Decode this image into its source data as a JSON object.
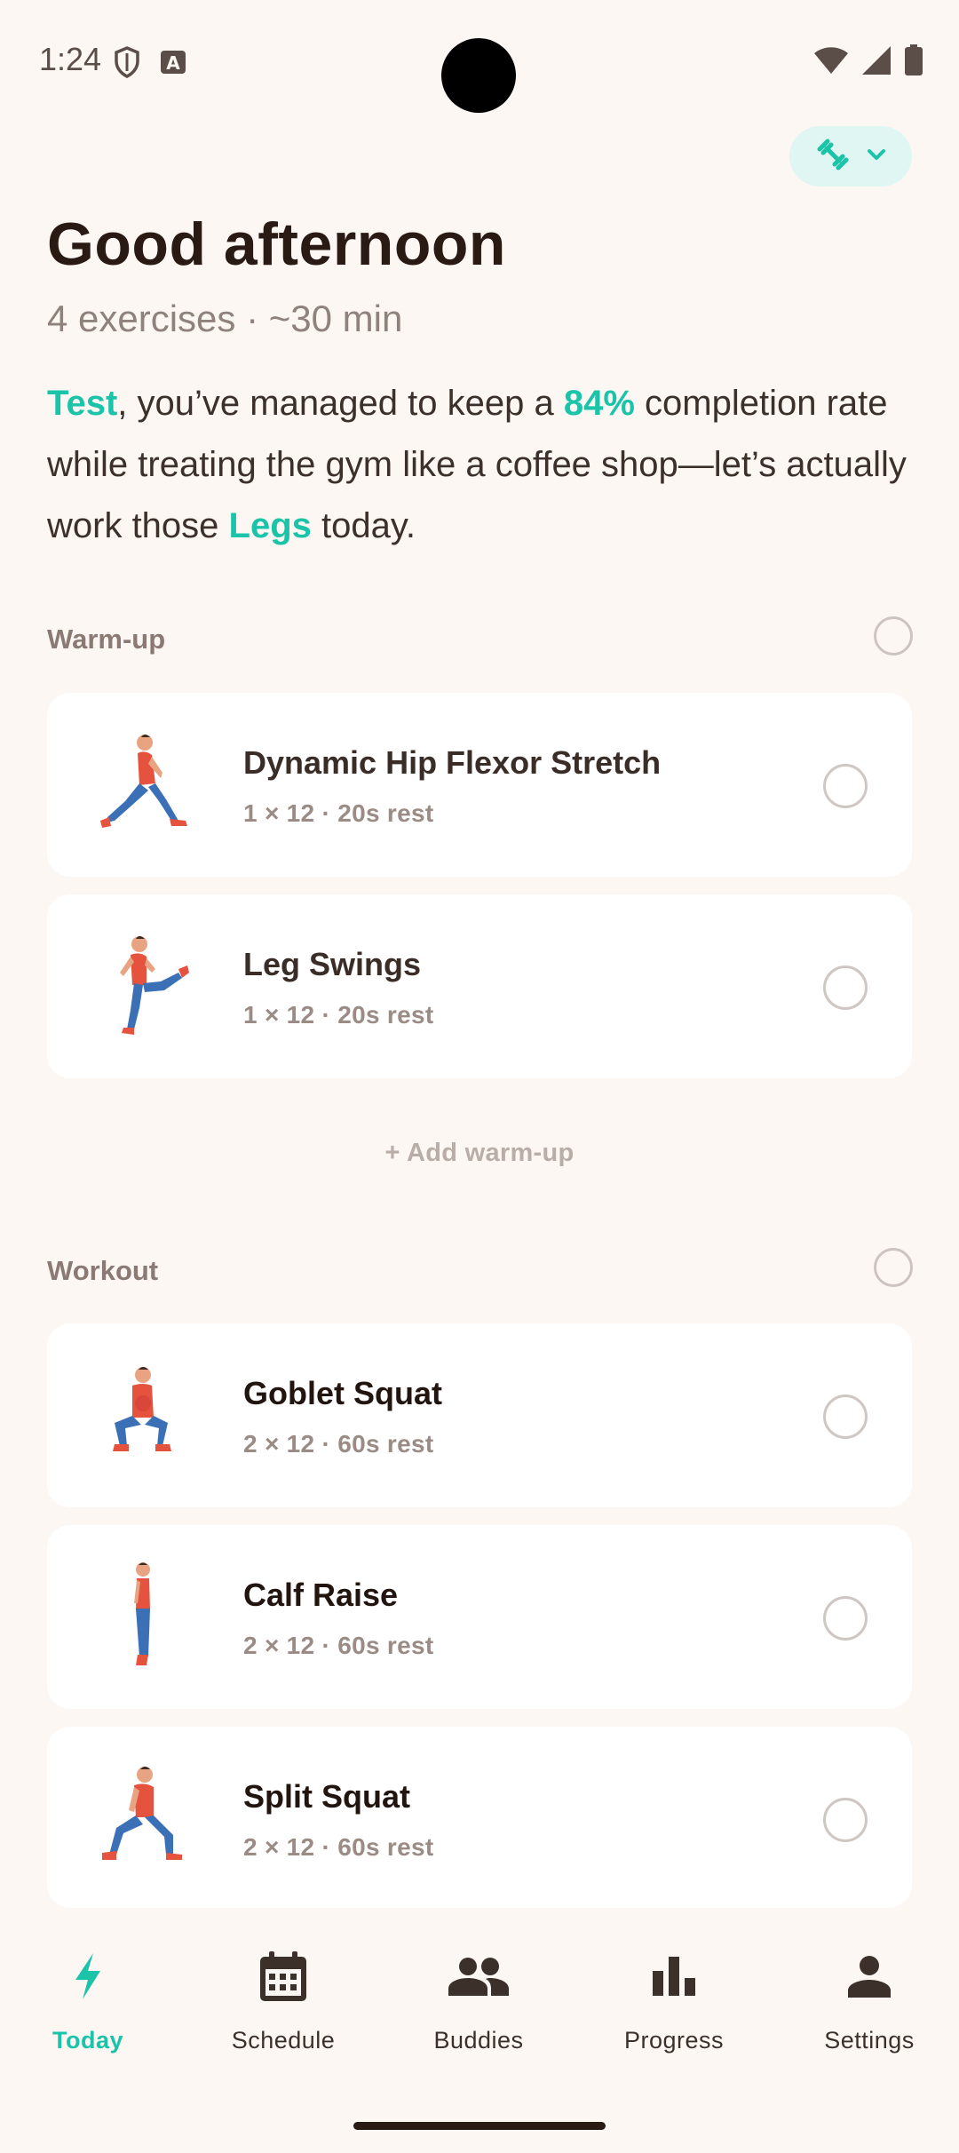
{
  "status_bar": {
    "time": "1:24",
    "icons": [
      "shield-icon",
      "keyboard-a-icon",
      "wifi-icon",
      "cell-signal-icon",
      "battery-icon"
    ]
  },
  "equipment_chip": {
    "icon": "dumbbell-icon",
    "chevron": "chevron-down-icon"
  },
  "header": {
    "greeting": "Good afternoon",
    "subtitle": "4 exercises · ~30 min"
  },
  "summary": {
    "name": "Test",
    "part1": ", you’ve managed to keep a ",
    "rate": "84%",
    "part2": " completion rate while treating the gym like a coffee shop—let’s actually work those ",
    "focus": "Legs",
    "part3": " today."
  },
  "warmup": {
    "title": "Warm-up",
    "items": [
      {
        "name": "Dynamic Hip Flexor Stretch",
        "meta": "1 × 12  ·  20s rest"
      },
      {
        "name": "Leg Swings",
        "meta": "1 × 12  ·  20s rest"
      }
    ],
    "add_label": "+  Add warm-up"
  },
  "workout": {
    "title": "Workout",
    "items": [
      {
        "name": "Goblet Squat",
        "meta": "2 × 12  ·  60s rest"
      },
      {
        "name": "Calf Raise",
        "meta": "2 × 12  ·  60s rest"
      },
      {
        "name": "Split Squat",
        "meta": "2 × 12  ·  60s rest"
      }
    ]
  },
  "nav": {
    "items": [
      {
        "label": "Today",
        "icon": "lightning-icon",
        "active": true
      },
      {
        "label": "Schedule",
        "icon": "calendar-icon",
        "active": false
      },
      {
        "label": "Buddies",
        "icon": "people-icon",
        "active": false
      },
      {
        "label": "Progress",
        "icon": "bar-chart-icon",
        "active": false
      },
      {
        "label": "Settings",
        "icon": "person-icon",
        "active": false
      }
    ]
  },
  "colors": {
    "accent": "#1BC4A8",
    "background": "#FDF7F4",
    "card": "#FFFFFF",
    "text": "#2A1A14"
  }
}
